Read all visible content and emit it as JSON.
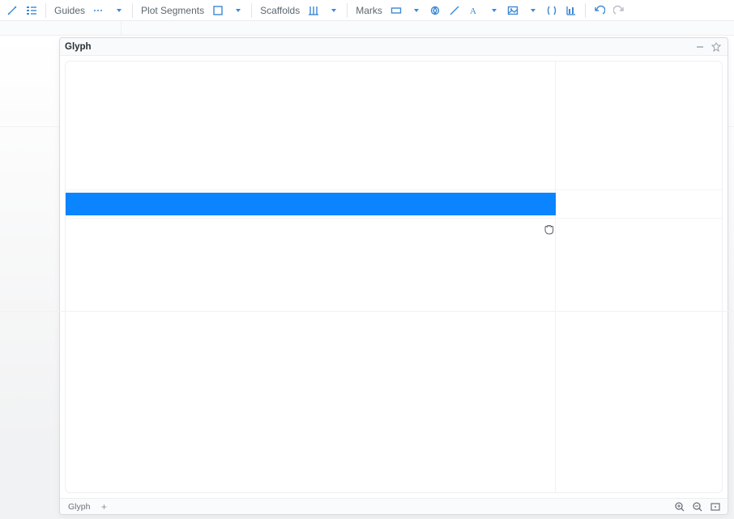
{
  "toolbar": {
    "guides_label": "Guides",
    "plot_segments_label": "Plot Segments",
    "scaffolds_label": "Scaffolds",
    "marks_label": "Marks"
  },
  "panel": {
    "title": "Glyph",
    "tab_label": "Glyph"
  }
}
